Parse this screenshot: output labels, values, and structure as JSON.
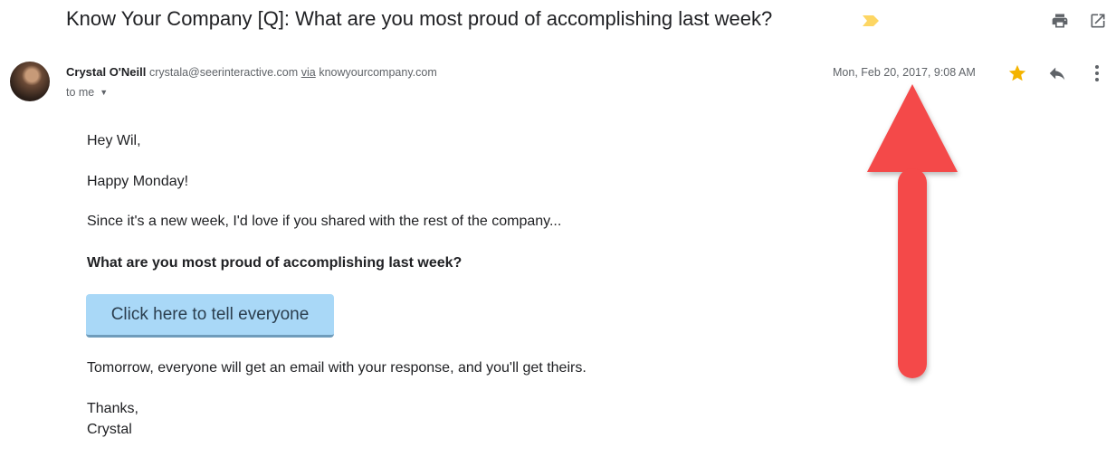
{
  "email": {
    "subject": "Know Your Company [Q]: What are you most proud of accomplishing last week?",
    "sender_name": "Crystal O'Neill",
    "sender_email": "crystala@seerinteractive.com",
    "via_label": "via",
    "via_domain": "knowyourcompany.com",
    "to_label": "to me",
    "date": "Mon, Feb 20, 2017, 9:08 AM",
    "starred": true
  },
  "body": {
    "greeting": "Hey Wil,",
    "line1": "Happy Monday!",
    "line2": "Since it's a new week, I'd love if you shared with the rest of the company...",
    "question": "What are you most proud of accomplishing last week?",
    "cta_label": "Click here to tell everyone",
    "line3": "Tomorrow, everyone will get an email with your response, and you'll get theirs.",
    "signoff": "Thanks,",
    "signature": "Crystal"
  },
  "icons": {
    "important": "important-marker-icon",
    "print": "print-icon",
    "popout": "open-in-new-window-icon",
    "star": "star-icon",
    "reply": "reply-icon",
    "more": "more-vert-icon",
    "annotation": "red-up-arrow"
  },
  "colors": {
    "important_marker": "#fdd663",
    "star": "#f4b400",
    "cta_background": "#a9d8f7",
    "annotation_arrow": "#f44848"
  }
}
